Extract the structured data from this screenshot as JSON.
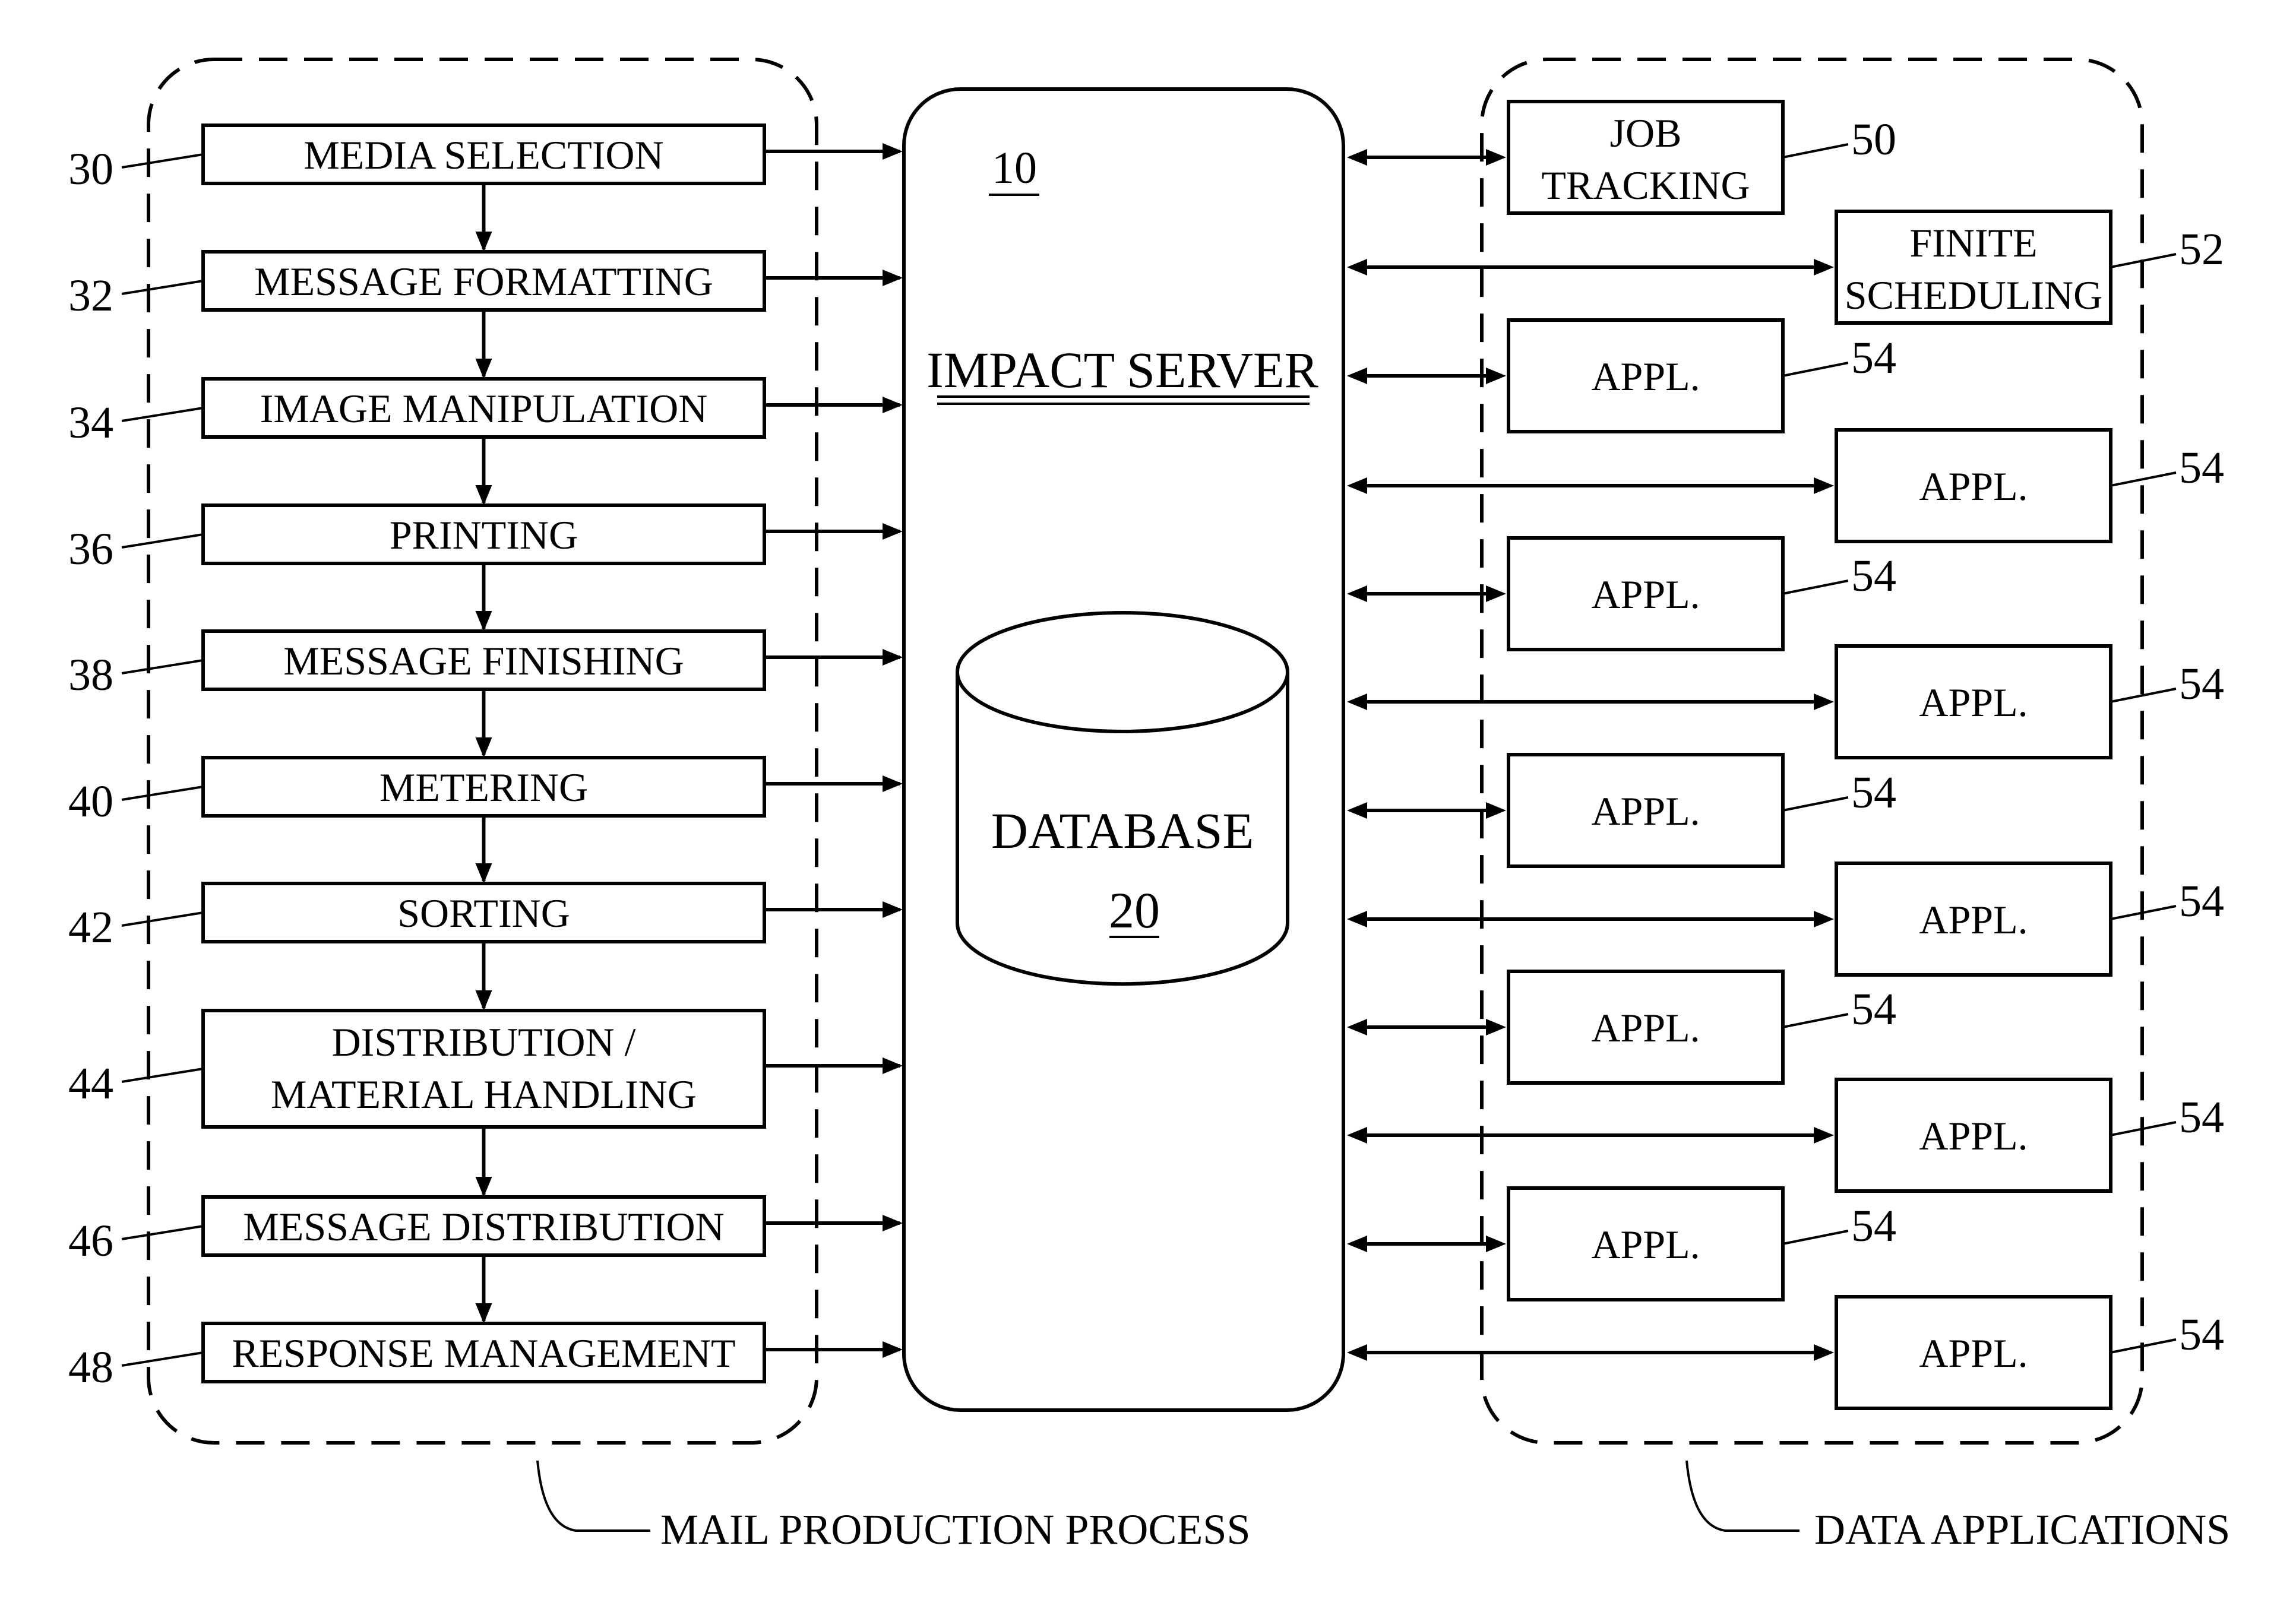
{
  "server": {
    "label": "IMPACT SERVER",
    "ref": "10"
  },
  "database": {
    "label": "DATABASE",
    "ref": "20"
  },
  "mail_process": {
    "caption": "MAIL PRODUCTION PROCESS",
    "steps": [
      {
        "ref": "30",
        "lines": [
          "MEDIA SELECTION"
        ]
      },
      {
        "ref": "32",
        "lines": [
          "MESSAGE FORMATTING"
        ]
      },
      {
        "ref": "34",
        "lines": [
          "IMAGE MANIPULATION"
        ]
      },
      {
        "ref": "36",
        "lines": [
          "PRINTING"
        ]
      },
      {
        "ref": "38",
        "lines": [
          "MESSAGE FINISHING"
        ]
      },
      {
        "ref": "40",
        "lines": [
          "METERING"
        ]
      },
      {
        "ref": "42",
        "lines": [
          "SORTING"
        ]
      },
      {
        "ref": "44",
        "lines": [
          "DISTRIBUTION /",
          "MATERIAL HANDLING"
        ]
      },
      {
        "ref": "46",
        "lines": [
          "MESSAGE DISTRIBUTION"
        ]
      },
      {
        "ref": "48",
        "lines": [
          "RESPONSE MANAGEMENT"
        ]
      }
    ]
  },
  "data_apps": {
    "caption": "DATA APPLICATIONS",
    "apps": [
      {
        "ref": "50",
        "lines": [
          "JOB",
          "TRACKING"
        ],
        "column": "left"
      },
      {
        "ref": "52",
        "lines": [
          "FINITE",
          "SCHEDULING"
        ],
        "column": "right"
      },
      {
        "ref": "54",
        "lines": [
          "APPL."
        ],
        "column": "left"
      },
      {
        "ref": "54",
        "lines": [
          "APPL."
        ],
        "column": "right"
      },
      {
        "ref": "54",
        "lines": [
          "APPL."
        ],
        "column": "left"
      },
      {
        "ref": "54",
        "lines": [
          "APPL."
        ],
        "column": "right"
      },
      {
        "ref": "54",
        "lines": [
          "APPL."
        ],
        "column": "left"
      },
      {
        "ref": "54",
        "lines": [
          "APPL."
        ],
        "column": "right"
      },
      {
        "ref": "54",
        "lines": [
          "APPL."
        ],
        "column": "left"
      },
      {
        "ref": "54",
        "lines": [
          "APPL."
        ],
        "column": "right"
      },
      {
        "ref": "54",
        "lines": [
          "APPL."
        ],
        "column": "left"
      },
      {
        "ref": "54",
        "lines": [
          "APPL."
        ],
        "column": "right"
      }
    ]
  }
}
